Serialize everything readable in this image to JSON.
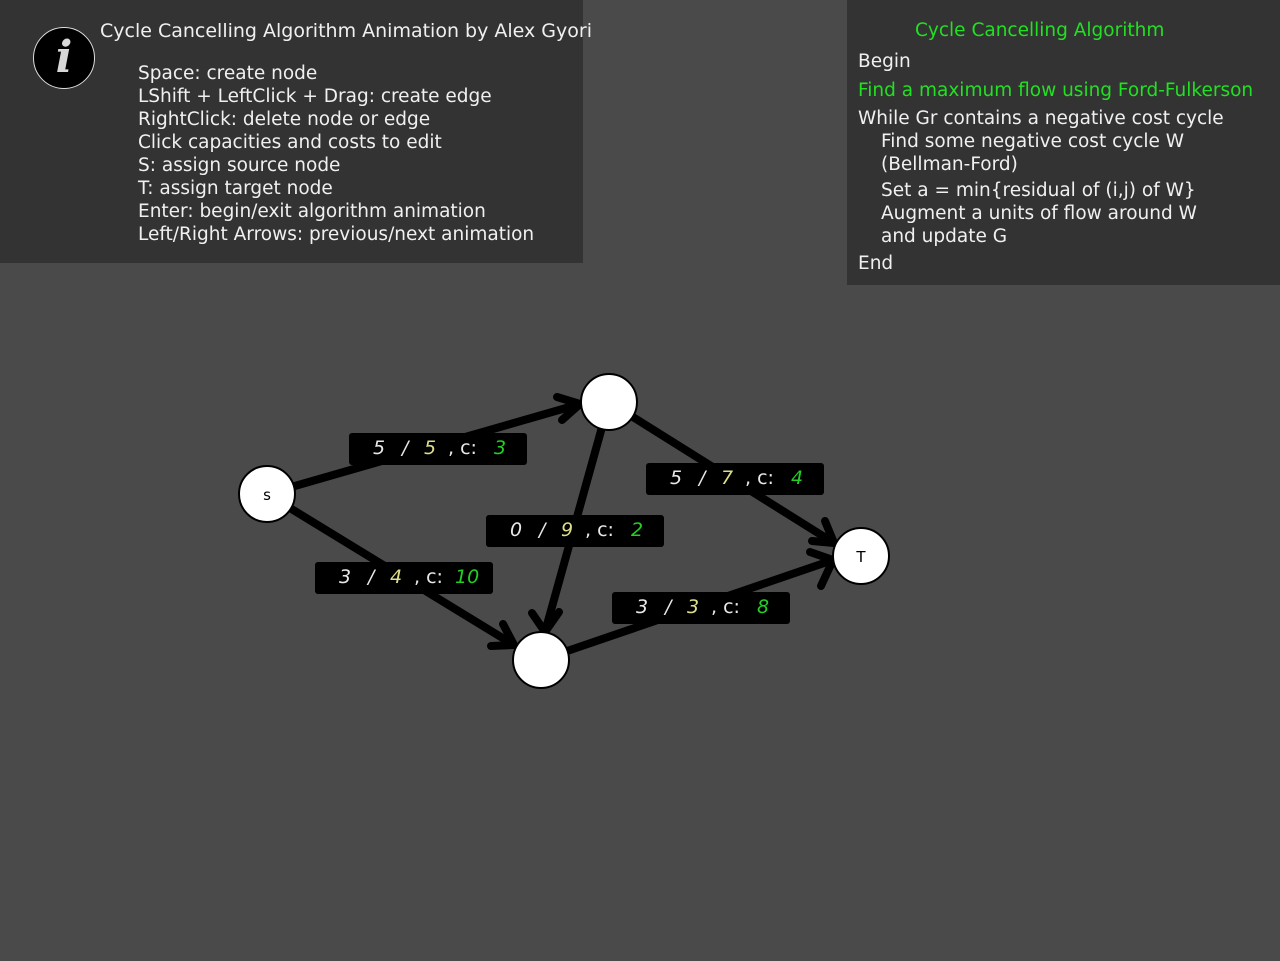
{
  "info": {
    "title": "Cycle Cancelling Algorithm Animation by Alex Gyori",
    "icon": "info-icon",
    "icon_glyph": "i",
    "instructions": [
      "Space: create node",
      "LShift + LeftClick + Drag: create edge",
      "RightClick: delete node or edge",
      "Click capacities and costs to edit",
      "S: assign source node",
      "T: assign target node",
      "Enter: begin/exit algorithm animation",
      "Left/Right Arrows: previous/next animation"
    ]
  },
  "algorithm": {
    "title": "Cycle Cancelling Algorithm",
    "lines": [
      "Begin",
      "Find a maximum flow using Ford-Fulkerson",
      "While Gr contains a negative cost cycle",
      "Find some negative cost cycle W",
      "(Bellman-Ford)",
      "Set a = min{residual of (i,j) of W}",
      "Augment a units of flow around W",
      "and update G",
      "End"
    ],
    "highlight_color": "#22e022"
  },
  "graph": {
    "nodes": [
      {
        "id": "s",
        "label": "s"
      },
      {
        "id": "top",
        "label": ""
      },
      {
        "id": "bottom",
        "label": ""
      },
      {
        "id": "t",
        "label": "T"
      }
    ],
    "edges": [
      {
        "id": "s-top",
        "flow": "5",
        "capacity": "5",
        "cost_prefix": ", c:",
        "cost": "3"
      },
      {
        "id": "top-t",
        "flow": "5",
        "capacity": "7",
        "cost_prefix": ", c:",
        "cost": "4"
      },
      {
        "id": "top-bottom",
        "flow": "0",
        "capacity": "9",
        "cost_prefix": ", c:",
        "cost": "2"
      },
      {
        "id": "s-bottom",
        "flow": "3",
        "capacity": "4",
        "cost_prefix": ", c:",
        "cost": "10"
      },
      {
        "id": "bottom-t",
        "flow": "3",
        "capacity": "3",
        "cost_prefix": ", c:",
        "cost": "8"
      }
    ]
  }
}
